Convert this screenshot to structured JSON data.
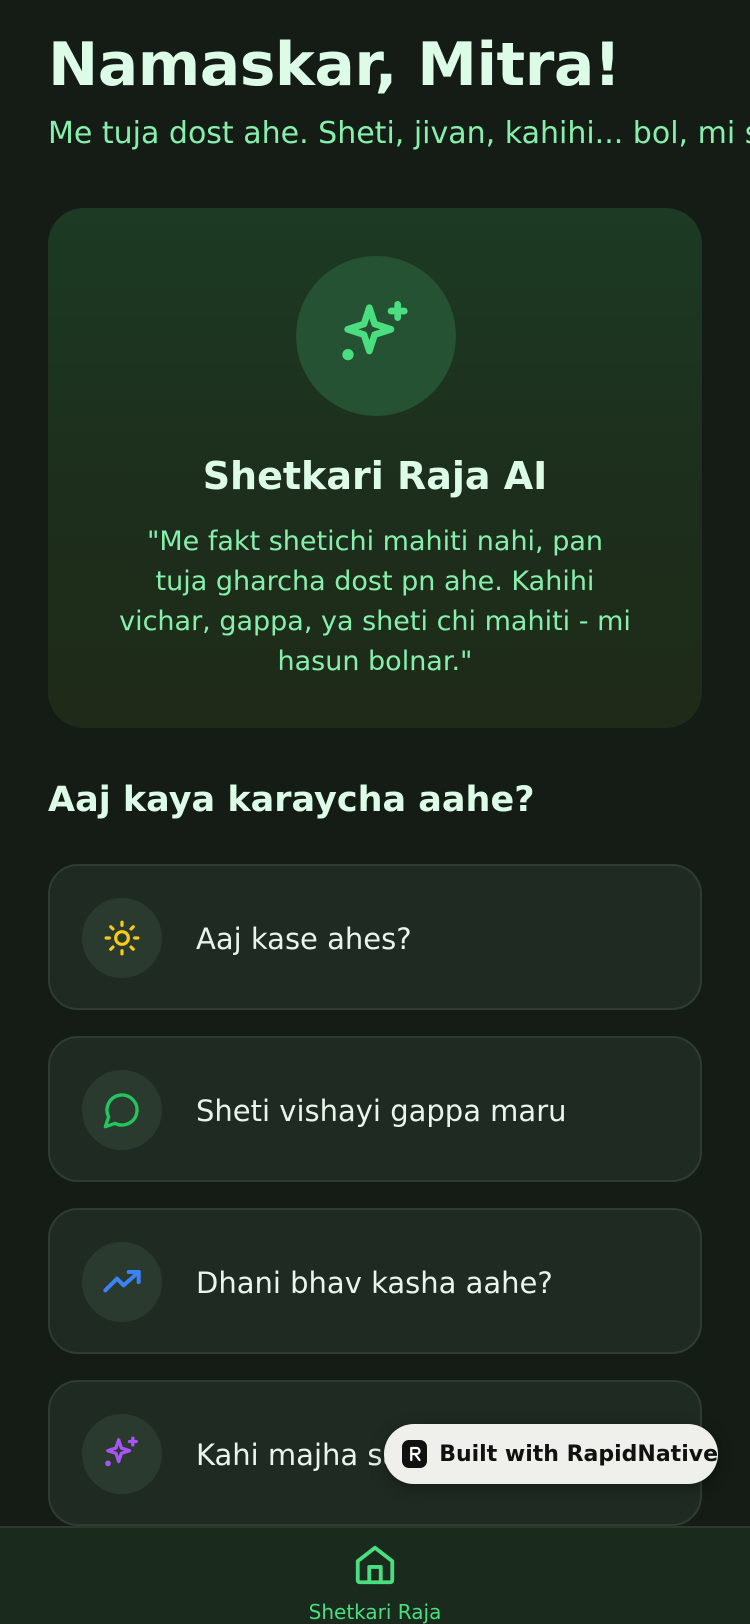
{
  "header": {
    "greeting": "Namaskar, Mitra!",
    "subtitle": "Me tuja dost ahe. Sheti, jivan, kahihi... bol, mi su"
  },
  "hero": {
    "icon": "sparkles-icon",
    "title": "Shetkari Raja AI",
    "quote": "\"Me fakt shetichi mahiti nahi, pan tuja gharcha dost pn ahe. Kahihi vichar, gappa, ya sheti chi mahiti - mi hasun bolnar.\""
  },
  "actions_section": {
    "title": "Aaj kaya karaycha aahe?",
    "items": [
      {
        "label": "Aaj kase ahes?",
        "icon": "sun-icon",
        "color": "#facc15"
      },
      {
        "label": "Sheti vishayi gappa maru",
        "icon": "chat-bubble-icon",
        "color": "#22c55e"
      },
      {
        "label": "Dhani bhav kasha aahe?",
        "icon": "trending-up-icon",
        "color": "#3b82f6"
      },
      {
        "label": "Kahi majha sar",
        "icon": "sparkles-icon",
        "color": "#a855f7"
      }
    ]
  },
  "badge": {
    "label": "Built with RapidNative"
  },
  "tabbar": {
    "tabs": [
      {
        "label": "Shetkari Raja",
        "icon": "home-icon",
        "active": true
      }
    ]
  },
  "colors": {
    "background": "#141c15",
    "accent": "#4ade80",
    "heading": "#dcfce7",
    "subtext": "#86efac"
  }
}
